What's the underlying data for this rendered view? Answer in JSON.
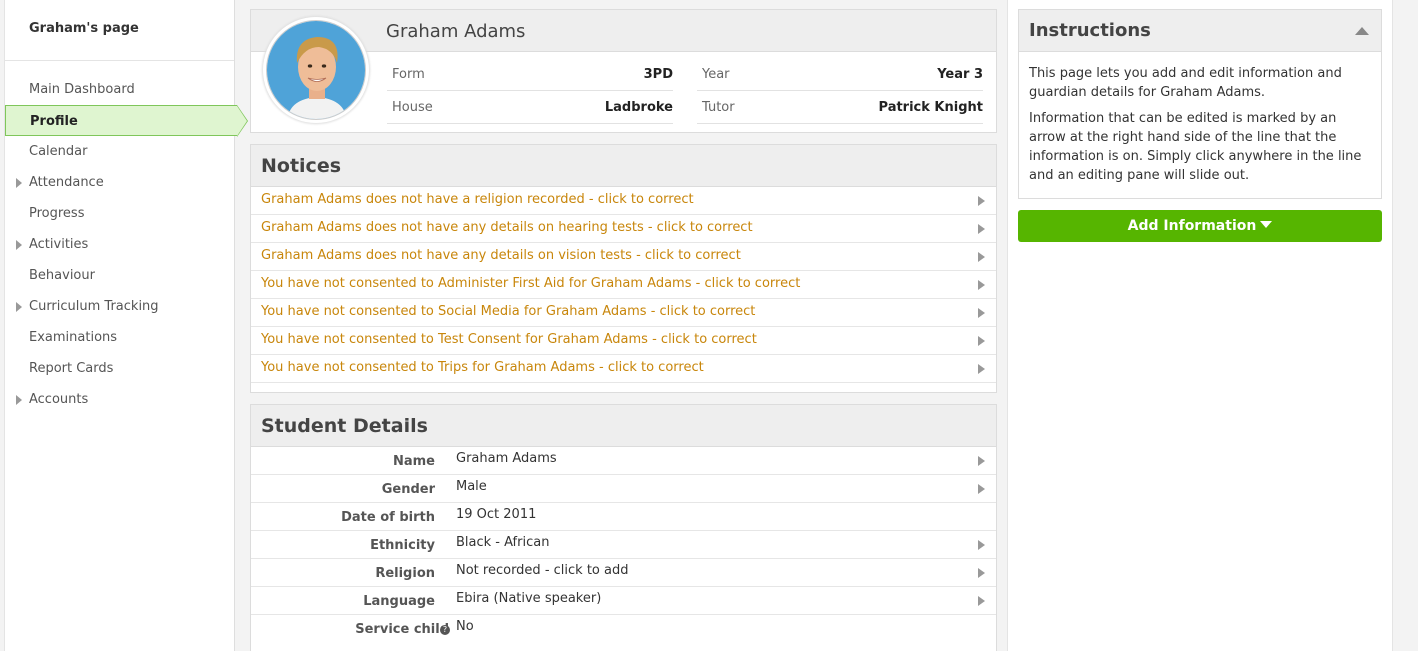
{
  "sidebar": {
    "title": "Graham's page",
    "items": [
      {
        "label": "Main Dashboard"
      },
      {
        "label": "Profile"
      },
      {
        "label": "Calendar"
      },
      {
        "label": "Attendance"
      },
      {
        "label": "Progress"
      },
      {
        "label": "Activities"
      },
      {
        "label": "Behaviour"
      },
      {
        "label": "Curriculum Tracking"
      },
      {
        "label": "Examinations"
      },
      {
        "label": "Report Cards"
      },
      {
        "label": "Accounts"
      }
    ]
  },
  "profile": {
    "name": "Graham Adams",
    "form_label": "Form",
    "form_value": "3PD",
    "year_label": "Year",
    "year_value": "Year 3",
    "house_label": "House",
    "house_value": "Ladbroke",
    "tutor_label": "Tutor",
    "tutor_value": "Patrick Knight"
  },
  "notices": {
    "title": "Notices",
    "items": [
      "Graham Adams does not have a religion recorded - click to correct",
      "Graham Adams does not have any details on hearing tests - click to correct",
      "Graham Adams does not have any details on vision tests - click to correct",
      "You have not consented to Administer First Aid for Graham Adams - click to correct",
      "You have not consented to Social Media for Graham Adams - click to correct",
      "You have not consented to Test Consent for Graham Adams - click to correct",
      "You have not consented to Trips for Graham Adams - click to correct"
    ]
  },
  "details": {
    "title": "Student Details",
    "rows": [
      {
        "label": "Name",
        "value": "Graham Adams"
      },
      {
        "label": "Gender",
        "value": "Male"
      },
      {
        "label": "Date of birth",
        "value": "19 Oct 2011"
      },
      {
        "label": "Ethnicity",
        "value": "Black - African"
      },
      {
        "label": "Religion",
        "value": "Not recorded - click to add"
      },
      {
        "label": "Language",
        "value": "Ebira (Native speaker)"
      },
      {
        "label": "Service child",
        "value": "No"
      }
    ]
  },
  "instructions": {
    "title": "Instructions",
    "p1": "This page lets you add and edit information and guardian details for Graham Adams.",
    "p2": "Information that can be edited is marked by an arrow at the right hand side of the line that the information is on. Simply click anywhere in the line and an editing pane will slide out."
  },
  "add_button": {
    "label": "Add Information"
  },
  "colors": {
    "accent_green": "#56b500",
    "notice_text": "#c8860b",
    "active_nav": "#dff5d0"
  }
}
